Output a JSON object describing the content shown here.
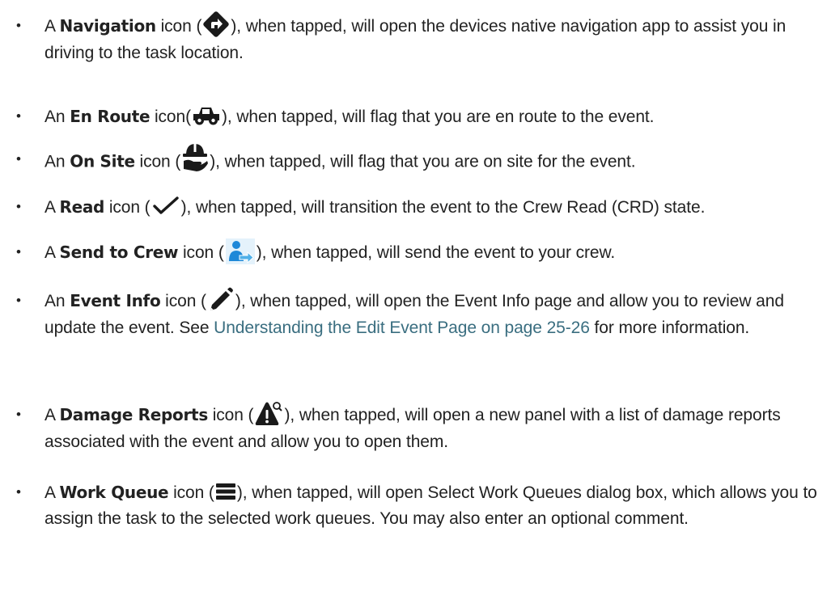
{
  "items": [
    {
      "article": "A",
      "keyword": "Navigation",
      "pre_icon": "icon (",
      "icon": "navigation-diamond-arrow-icon",
      "post_icon": "), when tapped, will open the devices native navigation app to assist you in driving to the task location."
    },
    {
      "article": "An",
      "keyword": "En Route",
      "pre_icon": "icon(",
      "icon": "truck-icon",
      "post_icon": "), when tapped, will flag that you are en route to the event."
    },
    {
      "article": "An",
      "keyword": "On Site",
      "pre_icon": "icon (",
      "icon": "hardhat-hand-icon",
      "post_icon": "), when tapped, will flag that you are on site for the event."
    },
    {
      "article": "A",
      "keyword": "Read",
      "pre_icon": "icon (",
      "icon": "checkmark-icon",
      "post_icon": "), when tapped, will transition the event to the Crew Read (CRD) state."
    },
    {
      "article": "A",
      "keyword": "Send to Crew",
      "pre_icon": "icon (",
      "icon": "send-to-crew-icon",
      "post_icon": "), when tapped, will send the event to your crew."
    },
    {
      "article": "An",
      "keyword": "Event Info",
      "pre_icon": "icon (",
      "icon": "pencil-icon",
      "post_icon": "), when tapped, will open the Event Info page and allow you to review and update the event. See ",
      "link": "Understanding the Edit Event Page on page 25-26",
      "post_link": " for more information."
    },
    {
      "article": "A",
      "keyword": "Damage Reports",
      "pre_icon": "icon (",
      "icon": "warning-search-icon",
      "post_icon": "), when tapped, will open a new panel with a list of damage reports associated with the event and allow you to open them."
    },
    {
      "article": "A",
      "keyword": "Work Queue",
      "pre_icon": "icon (",
      "icon": "hamburger-list-icon",
      "post_icon": "), when tapped, will open Select Work Queues dialog box, which allows you to assign the task to the selected work queues. You may also enter an optional comment."
    }
  ],
  "bullet": "•",
  "colors": {
    "text": "#222222",
    "link": "#3a6e80",
    "icon_dark": "#1a1a1a",
    "icon_blue": "#1e88d8",
    "icon_blue_bg": "#4fb0e8"
  }
}
